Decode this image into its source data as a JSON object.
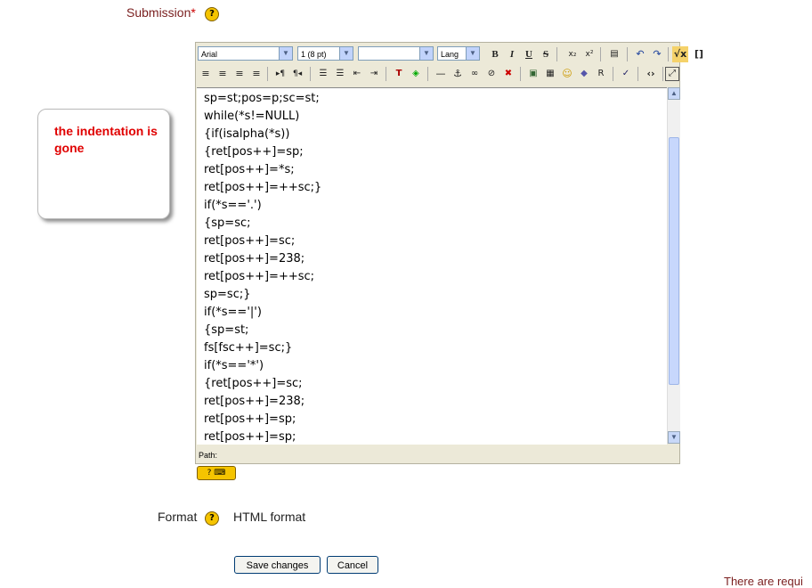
{
  "submission": {
    "label": "Submission",
    "required_marker": "*"
  },
  "editor": {
    "font_select": "Arial",
    "size_select": "1 (8 pt)",
    "style_select": "",
    "lang_select": "Lang",
    "path_label": "Path:",
    "code_lines": [
      "sp=st;pos=p;sc=st;",
      "while(*s!=NULL)",
      "{if(isalpha(*s))",
      "{ret[pos++]=sp;",
      "ret[pos++]=*s;",
      "ret[pos++]=++sc;}",
      "if(*s=='.')",
      "{sp=sc;",
      "ret[pos++]=sc;",
      "ret[pos++]=238;",
      "ret[pos++]=++sc;",
      "sp=sc;}",
      "if(*s=='|')",
      "{sp=st;",
      "fs[fsc++]=sc;}",
      "if(*s=='*')",
      "{ret[pos++]=sc;",
      "ret[pos++]=238;",
      "ret[pos++]=sp;",
      "ret[pos++]=sp;"
    ]
  },
  "callout": {
    "text": "the indentation is gone"
  },
  "format": {
    "label": "Format",
    "value": "HTML format"
  },
  "buttons": {
    "save": "Save changes",
    "cancel": "Cancel"
  },
  "required_note": "There are requi",
  "colors": {
    "label_red": "#7a1f1f",
    "callout_red": "#e00000",
    "editor_bg": "#ece9d8"
  }
}
